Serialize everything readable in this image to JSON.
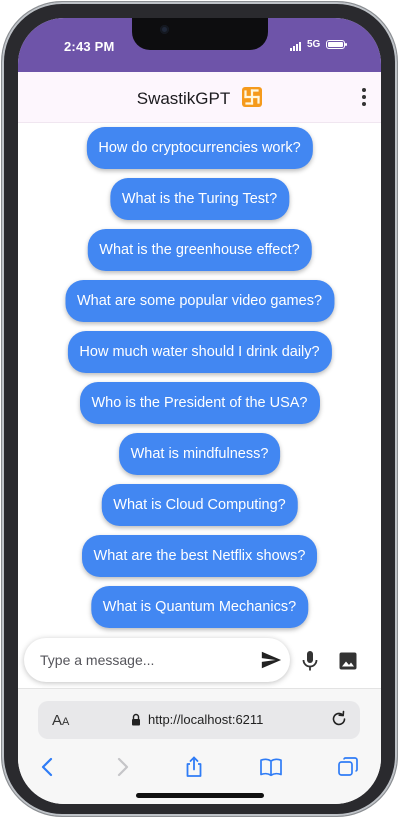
{
  "status_bar": {
    "time": "2:43 PM",
    "network": "5G"
  },
  "app_bar": {
    "title": "SwastikGPT",
    "logo_icon": "swastika-emoji-icon",
    "menu_icon": "more-vert-icon"
  },
  "suggestions": [
    {
      "label": "How do cryptocurrencies work?"
    },
    {
      "label": "What is the Turing Test?"
    },
    {
      "label": "What is the greenhouse effect?"
    },
    {
      "label": "What are some popular video games?"
    },
    {
      "label": "How much water should I drink daily?"
    },
    {
      "label": "Who is the President of the USA?"
    },
    {
      "label": "What is mindfulness?"
    },
    {
      "label": "What is Cloud Computing?"
    },
    {
      "label": "What are the best Netflix shows?"
    },
    {
      "label": "What is Quantum Mechanics?"
    }
  ],
  "composer": {
    "placeholder": "Type a message...",
    "send_icon": "send-icon",
    "mic_icon": "microphone-icon",
    "image_icon": "image-icon"
  },
  "browser": {
    "text_size_label_big": "A",
    "text_size_label_small": "A",
    "url": "http://localhost:6211",
    "nav_icons": [
      "back-icon",
      "forward-icon",
      "share-icon",
      "bookmarks-icon",
      "tabs-icon"
    ]
  },
  "colors": {
    "status_bar": "#6e54a9",
    "app_bar": "#fdf6fd",
    "suggestion_pill": "#4287f2",
    "browser_accent": "#2f7cf6"
  }
}
